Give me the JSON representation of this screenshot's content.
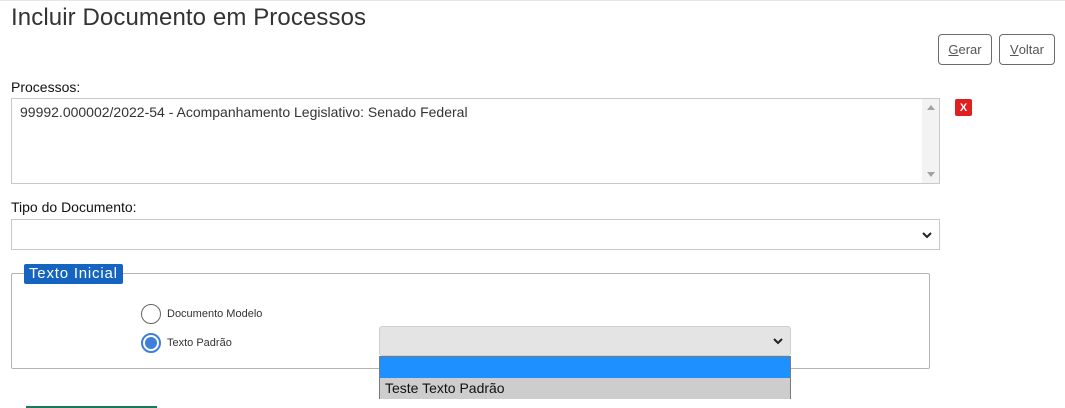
{
  "page_title": "Incluir Documento em Processos",
  "buttons": {
    "gerar": {
      "mnemonic": "G",
      "rest": "erar"
    },
    "voltar": {
      "mnemonic": "V",
      "rest": "oltar"
    }
  },
  "processos": {
    "label": "Processos:",
    "items": [
      "99992.000002/2022-54 - Acompanhamento Legislativo: Senado Federal"
    ],
    "remove_label": "X"
  },
  "tipo_documento": {
    "label": "Tipo do Documento:",
    "selected": ""
  },
  "texto_inicial": {
    "legend": "Texto Inicial",
    "options": [
      {
        "label": "Documento Modelo",
        "checked": false
      },
      {
        "label": "Texto Padrão",
        "checked": true
      }
    ],
    "select_value": "",
    "dropdown_options": [
      "",
      "Teste Texto Padrão"
    ]
  },
  "colors": {
    "legend_bg": "#1565c0",
    "remove_bg": "#e02020",
    "radio_accent": "#3d7fd9",
    "dropdown_highlight": "#1e90ff"
  }
}
